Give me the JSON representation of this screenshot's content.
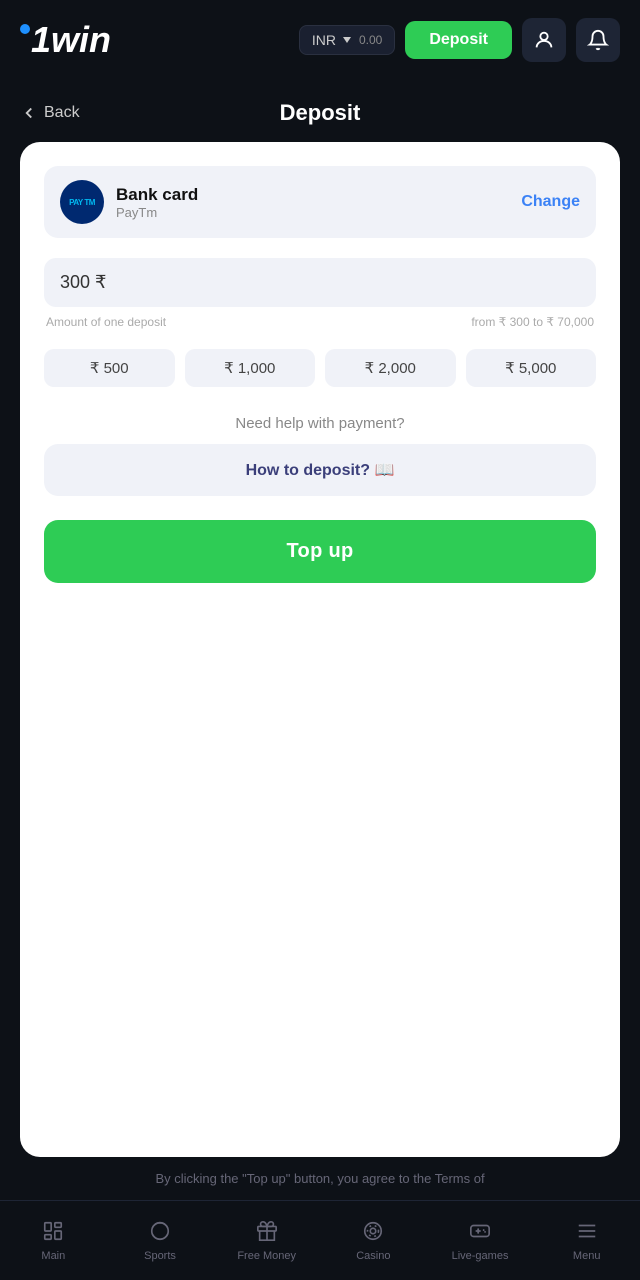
{
  "header": {
    "logo": "1win",
    "currency": "INR",
    "balance": "0.00",
    "deposit_label": "Deposit"
  },
  "page": {
    "back_label": "Back",
    "title": "Deposit"
  },
  "payment_method": {
    "logo_text": "PAY TM",
    "name": "Bank card",
    "sub": "PayTm",
    "change_label": "Change"
  },
  "amount": {
    "value": "300 ₹",
    "placeholder": "300 ₹",
    "hint_left": "Amount of one deposit",
    "hint_right": "from ₹ 300 to ₹ 70,000"
  },
  "quick_amounts": [
    "₹ 500",
    "₹ 1,000",
    "₹ 2,000",
    "₹ 5,000"
  ],
  "help": {
    "text": "Need help with payment?",
    "how_to_label": "How to deposit? 📖"
  },
  "top_up": {
    "label": "Top up"
  },
  "disclaimer": {
    "text": "By clicking the \"Top up\" button, you agree to the Terms of"
  },
  "bottom_nav": [
    {
      "id": "main",
      "label": "Main",
      "icon": "🖥",
      "active": false
    },
    {
      "id": "sports",
      "label": "Sports",
      "icon": "⚽",
      "active": false
    },
    {
      "id": "free-money",
      "label": "Free Money",
      "icon": "🎁",
      "active": false
    },
    {
      "id": "casino",
      "label": "Casino",
      "icon": "🎰",
      "active": false
    },
    {
      "id": "live-games",
      "label": "Live-games",
      "icon": "🎮",
      "active": false
    },
    {
      "id": "menu",
      "label": "Menu",
      "icon": "☰",
      "active": false
    }
  ]
}
